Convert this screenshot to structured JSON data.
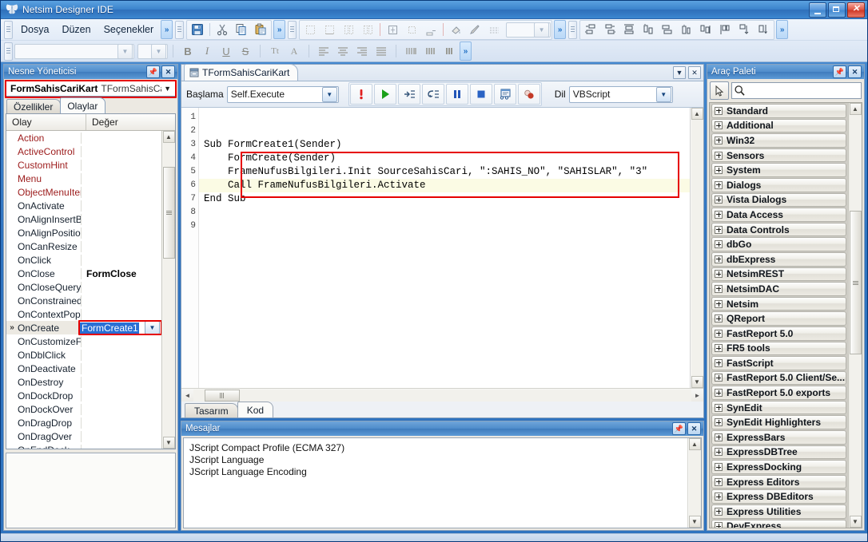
{
  "window": {
    "title": "Netsim Designer IDE",
    "app_icon": "butterfly-icon",
    "minimize": "–",
    "maximize": "□",
    "close": "✕"
  },
  "menu": {
    "items": [
      "Dosya",
      "Düzen",
      "Seçenekler"
    ],
    "overflow_chevron": "»",
    "handle": "☰"
  },
  "toolbar": {
    "file_group": [
      "save-icon",
      "cut-icon",
      "copy-icon",
      "paste-icon"
    ],
    "align_group": [
      "align-left-icon",
      "align-right-icon",
      "align-top-icon",
      "align-bottom-icon",
      "center-horiz-icon",
      "center-vert-icon",
      "space-equal-horiz-icon",
      "space-equal-vert-icon",
      "size-icon",
      "align-grid-icon"
    ],
    "format": {
      "font_name": "",
      "font_size": "",
      "bold": "B",
      "italic": "I",
      "underline": "U",
      "strike": "S",
      "font_size_icon": "Tt",
      "font_color_icon": "A",
      "align_left": "align-text-left-icon",
      "align_center": "align-text-center-icon",
      "align_right": "align-text-right-icon",
      "align_justify": "align-text-justify-icon"
    }
  },
  "object_inspector": {
    "title": "Nesne Yöneticisi",
    "pin": "➤",
    "close": "✕",
    "selector": {
      "name": "FormSahisCariKart",
      "type": "TFormSahisCari",
      "arrow": "▼"
    },
    "tabs": [
      {
        "label": "Özellikler",
        "active": false
      },
      {
        "label": "Olaylar",
        "active": true
      }
    ],
    "columns": [
      "Olay",
      "Değer"
    ],
    "rows": [
      {
        "name": "Action",
        "value": "",
        "red": true,
        "selected": false
      },
      {
        "name": "ActiveControl",
        "value": "",
        "red": true,
        "selected": false
      },
      {
        "name": "CustomHint",
        "value": "",
        "red": true,
        "selected": false
      },
      {
        "name": "Menu",
        "value": "",
        "red": true,
        "selected": false
      },
      {
        "name": "ObjectMenuIten",
        "value": "",
        "red": true,
        "selected": false
      },
      {
        "name": "OnActivate",
        "value": "",
        "red": false,
        "selected": false
      },
      {
        "name": "OnAlignInsertBe",
        "value": "",
        "red": false,
        "selected": false
      },
      {
        "name": "OnAlignPosition",
        "value": "",
        "red": false,
        "selected": false
      },
      {
        "name": "OnCanResize",
        "value": "",
        "red": false,
        "selected": false
      },
      {
        "name": "OnClick",
        "value": "",
        "red": false,
        "selected": false
      },
      {
        "name": "OnClose",
        "value": "FormClose",
        "red": false,
        "selected": false
      },
      {
        "name": "OnCloseQuery",
        "value": "",
        "red": false,
        "selected": false
      },
      {
        "name": "OnConstrainedR",
        "value": "",
        "red": false,
        "selected": false
      },
      {
        "name": "OnContextPopu",
        "value": "",
        "red": false,
        "selected": false
      },
      {
        "name": "OnCreate",
        "value": "FormCreate1",
        "red": false,
        "selected": true,
        "marker": "»"
      },
      {
        "name": "OnCustomizeFor",
        "value": "",
        "red": false,
        "selected": false
      },
      {
        "name": "OnDblClick",
        "value": "",
        "red": false,
        "selected": false
      },
      {
        "name": "OnDeactivate",
        "value": "",
        "red": false,
        "selected": false
      },
      {
        "name": "OnDestroy",
        "value": "",
        "red": false,
        "selected": false
      },
      {
        "name": "OnDockDrop",
        "value": "",
        "red": false,
        "selected": false
      },
      {
        "name": "OnDockOver",
        "value": "",
        "red": false,
        "selected": false
      },
      {
        "name": "OnDragDrop",
        "value": "",
        "red": false,
        "selected": false
      },
      {
        "name": "OnDragOver",
        "value": "",
        "red": false,
        "selected": false
      },
      {
        "name": "OnEndDock",
        "value": "",
        "red": false,
        "selected": false
      }
    ],
    "editing_value": "FormCreate1",
    "dropdown_arrow": "▼"
  },
  "editor": {
    "document_tab": "TFormSahisCariKart",
    "tab_icon": "form-icon",
    "tab_menu": "▼",
    "tab_close": "✕",
    "start_label": "Başlama",
    "start_value": "Self.Execute",
    "language_label": "Dil",
    "language_value": "VBScript",
    "debug_buttons": [
      "syntax-check-icon",
      "run-icon",
      "step-into-icon",
      "step-over-icon",
      "pause-icon",
      "stop-icon",
      "watch-icon",
      "breakpoint-icon"
    ],
    "line_numbers": [
      "1",
      "2",
      "3",
      "4",
      "5",
      "6",
      "7",
      "8",
      "9"
    ],
    "code_lines": [
      {
        "text": "",
        "highlight": false
      },
      {
        "text": "",
        "highlight": false
      },
      {
        "text": "Sub FormCreate1(Sender)",
        "highlight": false
      },
      {
        "text": "    FormCreate(Sender)",
        "highlight": false
      },
      {
        "text": "    FrameNufusBilgileri.Init SourceSahisCari, \":SAHIS_NO\", \"SAHISLAR\", \"3\"",
        "highlight": false
      },
      {
        "text": "    Call FrameNufusBilgileri.Activate",
        "highlight": true
      },
      {
        "text": "End Sub",
        "highlight": false
      },
      {
        "text": "",
        "highlight": false
      },
      {
        "text": "",
        "highlight": false
      }
    ],
    "tabs": [
      {
        "label": "Tasarım",
        "active": false
      },
      {
        "label": "Kod",
        "active": true
      }
    ]
  },
  "messages": {
    "title": "Mesajlar",
    "pin": "➤",
    "close": "✕",
    "lines": [
      "JScript Compact Profile (ECMA 327)",
      "JScript Language",
      "JScript Language Encoding"
    ]
  },
  "tool_palette": {
    "title": "Araç Paleti",
    "pin": "➤",
    "close": "✕",
    "pointer_icon": "arrow-cursor-icon",
    "search_icon": "search-icon",
    "search_value": "",
    "categories": [
      "Standard",
      "Additional",
      "Win32",
      "Sensors",
      "System",
      "Dialogs",
      "Vista Dialogs",
      "Data Access",
      "Data Controls",
      "dbGo",
      "dbExpress",
      "NetsimREST",
      "NetsimDAC",
      "Netsim",
      "QReport",
      "FastReport 5.0",
      "FR5 tools",
      "FastScript",
      "FastReport 5.0 Client/Se...",
      "FastReport 5.0 exports",
      "SynEdit",
      "SynEdit Highlighters",
      "ExpressBars",
      "ExpressDBTree",
      "ExpressDocking",
      "Express Editors",
      "Express DBEditors",
      "Express Utilities",
      "DevExpress"
    ],
    "expander": "+"
  },
  "colors": {
    "accent": "#2f73bf",
    "annotation": "#e60000",
    "selection": "#2a6fd4",
    "red_property": "#9c1b1b",
    "highlight_line": "#fbfbe4"
  },
  "scrollbars": {
    "up": "▲",
    "down": "▼",
    "left": "◄",
    "right": "►"
  }
}
